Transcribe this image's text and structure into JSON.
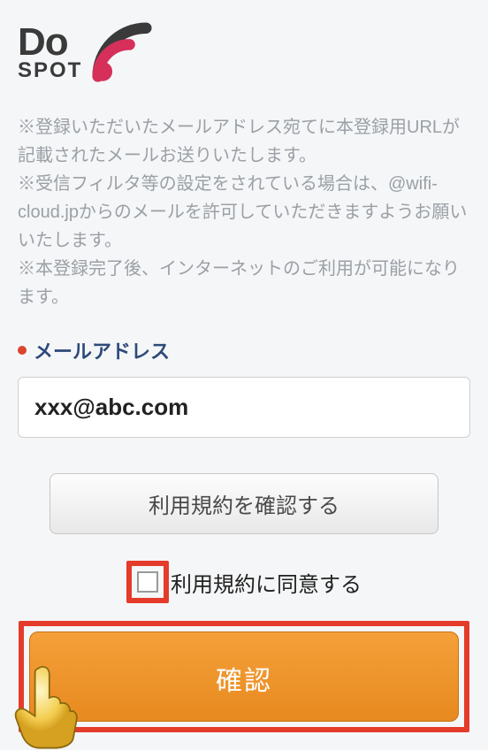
{
  "logo": {
    "top": "Do",
    "bottom": "SPOT"
  },
  "info": {
    "line1": "※登録いただいたメールアドレス宛てに本登録用URLが記載されたメールお送りいたします。",
    "line2": "※受信フィルタ等の設定をされている場合は、@wifi-cloud.jpからのメールを許可していただきますようお願いいたします。",
    "line3": "※本登録完了後、インターネットのご利用が可能になります。"
  },
  "field": {
    "label": "メールアドレス",
    "value": "xxx@abc.com"
  },
  "termsButton": "利用規約を確認する",
  "checkboxLabel": "利用規約に同意する",
  "confirmButton": "確認"
}
